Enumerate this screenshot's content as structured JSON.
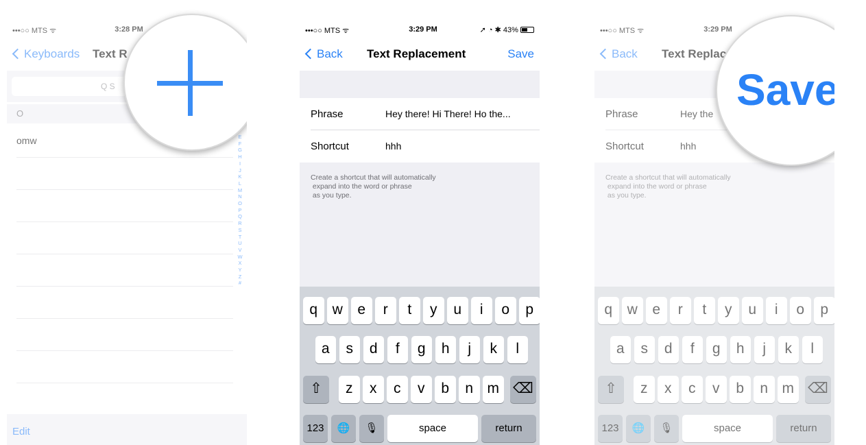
{
  "accent_color": "#2a82f6",
  "panel1": {
    "status": {
      "carrier": "•••○○ MTS ᯤ",
      "time": "3:28 PM"
    },
    "nav": {
      "back": "Keyboards",
      "title": "Text R"
    },
    "search_placeholder": "Q S",
    "section_header": "O",
    "items": [
      "omw"
    ],
    "index_letters": [
      "E",
      "F",
      "G",
      "H",
      "I",
      "J",
      "K",
      "L",
      "M",
      "N",
      "O",
      "P",
      "Q",
      "R",
      "S",
      "T",
      "U",
      "V",
      "W",
      "X",
      "Y",
      "Z",
      "#"
    ],
    "edit_label": "Edit",
    "magnifier_icon": "plus-icon"
  },
  "panel2": {
    "status": {
      "carrier": "•••○○ MTS ᯤ",
      "time": "3:29 PM",
      "right": "➚ ◔ ✱ 43%"
    },
    "nav": {
      "back": "Back",
      "title": "Text Replacement",
      "save": "Save"
    },
    "phrase_label": "Phrase",
    "phrase_value": "Hey there! Hi There! Ho the...",
    "shortcut_label": "Shortcut",
    "shortcut_value": "hhh",
    "hint_lines": [
      "Create a shortcut that will automatically",
      " expand into the word or phrase",
      " as you type."
    ],
    "keyboard": {
      "row1": [
        "q",
        "w",
        "e",
        "r",
        "t",
        "y",
        "u",
        "i",
        "o",
        "p"
      ],
      "row2": [
        "a",
        "s",
        "d",
        "f",
        "g",
        "h",
        "j",
        "k",
        "l"
      ],
      "row3": [
        "z",
        "x",
        "c",
        "v",
        "b",
        "n",
        "m"
      ],
      "shift": "⇧",
      "backspace": "⌫",
      "numbers": "123",
      "globe": "🌐",
      "mic": "🎙",
      "space": "space",
      "return": "return"
    }
  },
  "panel3": {
    "status": {
      "carrier": "•••○○ MTS ᯤ",
      "time": "3:29 PM"
    },
    "nav": {
      "back": "Back",
      "title": "Text Replac"
    },
    "phrase_label": "Phrase",
    "phrase_value": "Hey the",
    "shortcut_label": "Shortcut",
    "shortcut_value": "hhh",
    "hint_lines": [
      "Create a shortcut that will automatically",
      " expand into the word or phrase",
      " as you type."
    ],
    "magnifier_text": "Save"
  }
}
